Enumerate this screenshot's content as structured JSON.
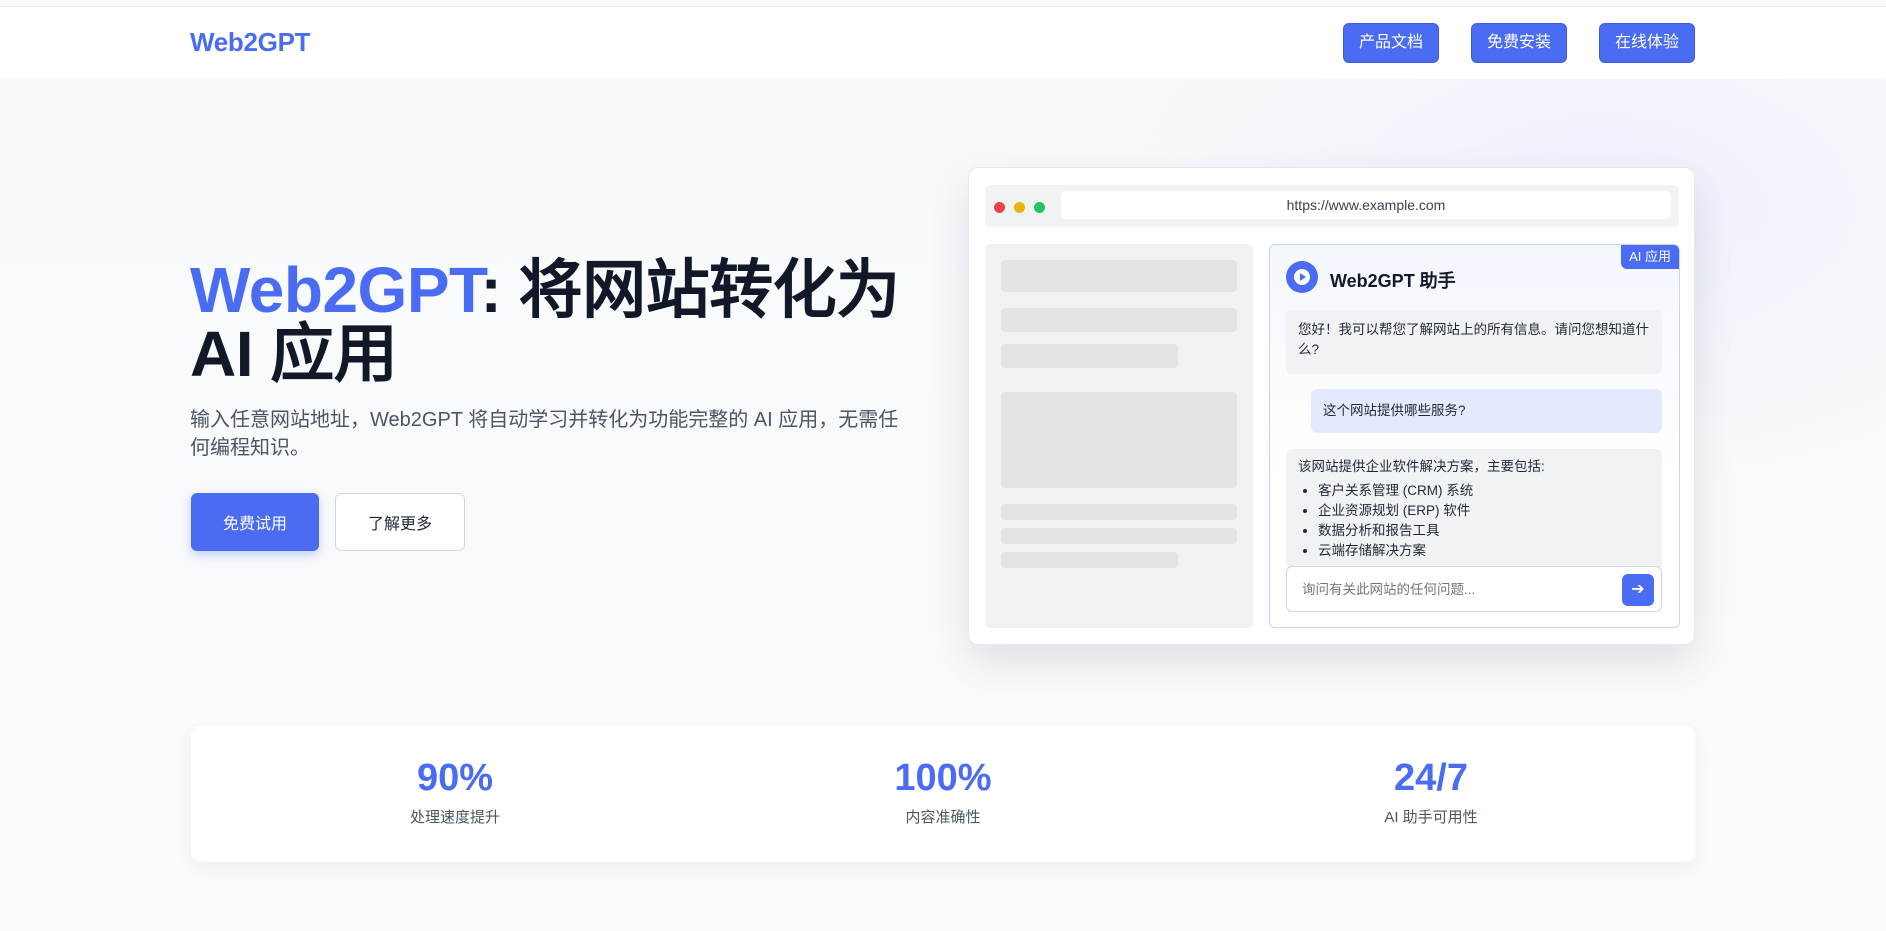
{
  "nav": {
    "logo": "Web2GPT",
    "buttons": [
      "产品文档",
      "免费安装",
      "在线体验"
    ]
  },
  "hero": {
    "title_accent": "Web2GPT",
    "title_rest": ": 将网站转化为 AI 应用",
    "subtitle": "输入任意网站地址，Web2GPT 将自动学习并转化为功能完整的 AI 应用，无需任何编程知识。",
    "primary_button": "免费试用",
    "secondary_button": "了解更多"
  },
  "mockup": {
    "url": "https://www.example.com",
    "chat": {
      "badge": "AI 应用",
      "title": "Web2GPT 助手",
      "greeting": "您好！我可以帮您了解网站上的所有信息。请问您想知道什么?",
      "user_question": "这个网站提供哪些服务?",
      "answer_intro": "该网站提供企业软件解决方案，主要包括:",
      "answer_items": [
        "客户关系管理 (CRM) 系统",
        "企业资源规划 (ERP) 软件",
        "数据分析和报告工具",
        "云端存储解决方案"
      ],
      "input_placeholder": "询问有关此网站的任何问题...",
      "send_icon": "arrow-right-icon"
    }
  },
  "stats": [
    {
      "value": "90%",
      "label": "处理速度提升"
    },
    {
      "value": "100%",
      "label": "内容准确性"
    },
    {
      "value": "24/7",
      "label": "AI 助手可用性"
    }
  ],
  "colors": {
    "accent": "#4a6cf2",
    "heading": "#111827",
    "muted": "#4b5563"
  }
}
